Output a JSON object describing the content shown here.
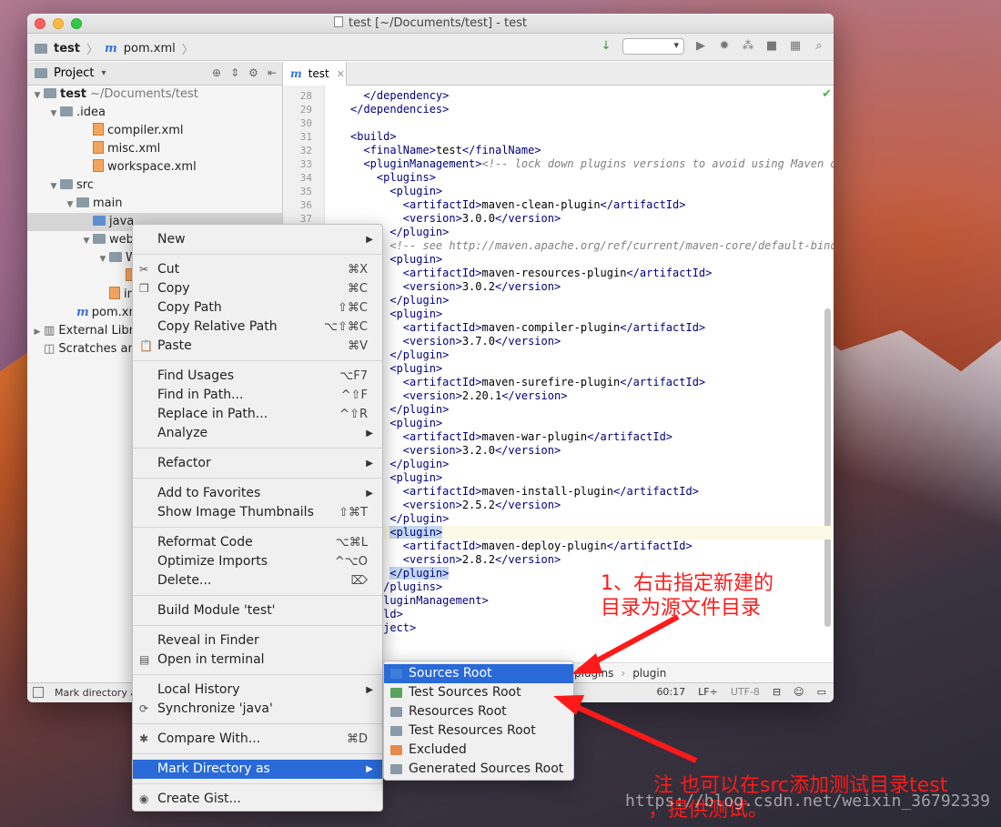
{
  "window": {
    "title": "test [~/Documents/test] - test"
  },
  "navbar": {
    "crumb_project": "test",
    "crumb_file": "pom.xml"
  },
  "project_panel": {
    "title": "Project",
    "tree": [
      {
        "label": "test",
        "suffix": "~/Documents/test",
        "indent": 0,
        "arrow": "▼",
        "icon": "folder"
      },
      {
        "label": ".idea",
        "indent": 1,
        "arrow": "▼",
        "icon": "folder"
      },
      {
        "label": "compiler.xml",
        "indent": 3,
        "arrow": "",
        "icon": "xml"
      },
      {
        "label": "misc.xml",
        "indent": 3,
        "arrow": "",
        "icon": "xml"
      },
      {
        "label": "workspace.xml",
        "indent": 3,
        "arrow": "",
        "icon": "xml"
      },
      {
        "label": "src",
        "indent": 1,
        "arrow": "▼",
        "icon": "folder"
      },
      {
        "label": "main",
        "indent": 2,
        "arrow": "▼",
        "icon": "folder"
      },
      {
        "label": "java",
        "indent": 3,
        "arrow": "",
        "icon": "folder",
        "selected": true
      },
      {
        "label": "web",
        "indent": 3,
        "arrow": "▼",
        "icon": "folder"
      },
      {
        "label": "W",
        "indent": 4,
        "arrow": "▼",
        "icon": "folder"
      },
      {
        "label": "",
        "indent": 5,
        "arrow": "",
        "icon": "xml"
      },
      {
        "label": "in",
        "indent": 4,
        "arrow": "",
        "icon": "xml"
      },
      {
        "label": "pom.xml",
        "indent": 2,
        "arrow": "",
        "icon": "m"
      },
      {
        "label": "External Libra",
        "indent": 0,
        "arrow": "▶",
        "icon": "lib"
      },
      {
        "label": "Scratches an",
        "indent": 0,
        "arrow": "",
        "icon": "scratch"
      }
    ]
  },
  "editor": {
    "tab_label": "test",
    "breadcrumb": [
      "plugins",
      "plugin"
    ],
    "lines": [
      {
        "n": "28",
        "indent": "  ",
        "parts": [
          [
            "tag",
            "</dependency>"
          ]
        ]
      },
      {
        "n": "29",
        "indent": "",
        "parts": [
          [
            "tag",
            "</dependencies>"
          ]
        ]
      },
      {
        "n": "30",
        "indent": "",
        "parts": []
      },
      {
        "n": "31",
        "indent": "",
        "parts": [
          [
            "tag",
            "<build>"
          ]
        ]
      },
      {
        "n": "32",
        "indent": "  ",
        "parts": [
          [
            "tag",
            "<finalName>"
          ],
          [
            "txt",
            "test"
          ],
          [
            "tag",
            "</finalName>"
          ]
        ]
      },
      {
        "n": "33",
        "indent": "  ",
        "parts": [
          [
            "tag",
            "<pluginManagement>"
          ],
          [
            "comment",
            "<!-- lock down plugins versions to avoid using Maven def"
          ]
        ]
      },
      {
        "n": "34",
        "indent": "    ",
        "parts": [
          [
            "tag",
            "<plugins>"
          ]
        ]
      },
      {
        "n": "35",
        "indent": "      ",
        "parts": [
          [
            "tag",
            "<plugin>"
          ]
        ]
      },
      {
        "n": "36",
        "indent": "        ",
        "parts": [
          [
            "tag",
            "<artifactId>"
          ],
          [
            "txt",
            "maven-clean-plugin"
          ],
          [
            "tag",
            "</artifactId>"
          ]
        ]
      },
      {
        "n": "37",
        "indent": "        ",
        "parts": [
          [
            "tag",
            "<version>"
          ],
          [
            "txt",
            "3.0.0"
          ],
          [
            "tag",
            "</version>"
          ]
        ]
      },
      {
        "n": "",
        "indent": "      ",
        "parts": [
          [
            "tag",
            "</plugin>"
          ]
        ]
      },
      {
        "n": "",
        "indent": "      ",
        "parts": [
          [
            "comment",
            "<!-- see http://maven.apache.org/ref/current/maven-core/default-bindin"
          ]
        ]
      },
      {
        "n": "",
        "indent": "      ",
        "parts": [
          [
            "tag",
            "<plugin>"
          ]
        ]
      },
      {
        "n": "",
        "indent": "        ",
        "parts": [
          [
            "tag",
            "<artifactId>"
          ],
          [
            "txt",
            "maven-resources-plugin"
          ],
          [
            "tag",
            "</artifactId>"
          ]
        ]
      },
      {
        "n": "",
        "indent": "        ",
        "parts": [
          [
            "tag",
            "<version>"
          ],
          [
            "txt",
            "3.0.2"
          ],
          [
            "tag",
            "</version>"
          ]
        ]
      },
      {
        "n": "",
        "indent": "      ",
        "parts": [
          [
            "tag",
            "</plugin>"
          ]
        ]
      },
      {
        "n": "",
        "indent": "      ",
        "parts": [
          [
            "tag",
            "<plugin>"
          ]
        ]
      },
      {
        "n": "",
        "indent": "        ",
        "parts": [
          [
            "tag",
            "<artifactId>"
          ],
          [
            "txt",
            "maven-compiler-plugin"
          ],
          [
            "tag",
            "</artifactId>"
          ]
        ]
      },
      {
        "n": "",
        "indent": "        ",
        "parts": [
          [
            "tag",
            "<version>"
          ],
          [
            "txt",
            "3.7.0"
          ],
          [
            "tag",
            "</version>"
          ]
        ]
      },
      {
        "n": "",
        "indent": "      ",
        "parts": [
          [
            "tag",
            "</plugin>"
          ]
        ]
      },
      {
        "n": "",
        "indent": "      ",
        "parts": [
          [
            "tag",
            "<plugin>"
          ]
        ]
      },
      {
        "n": "",
        "indent": "        ",
        "parts": [
          [
            "tag",
            "<artifactId>"
          ],
          [
            "txt",
            "maven-surefire-plugin"
          ],
          [
            "tag",
            "</artifactId>"
          ]
        ]
      },
      {
        "n": "",
        "indent": "        ",
        "parts": [
          [
            "tag",
            "<version>"
          ],
          [
            "txt",
            "2.20.1"
          ],
          [
            "tag",
            "</version>"
          ]
        ]
      },
      {
        "n": "",
        "indent": "      ",
        "parts": [
          [
            "tag",
            "</plugin>"
          ]
        ]
      },
      {
        "n": "",
        "indent": "      ",
        "parts": [
          [
            "tag",
            "<plugin>"
          ]
        ]
      },
      {
        "n": "",
        "indent": "        ",
        "parts": [
          [
            "tag",
            "<artifactId>"
          ],
          [
            "txt",
            "maven-war-plugin"
          ],
          [
            "tag",
            "</artifactId>"
          ]
        ]
      },
      {
        "n": "",
        "indent": "        ",
        "parts": [
          [
            "tag",
            "<version>"
          ],
          [
            "txt",
            "3.2.0"
          ],
          [
            "tag",
            "</version>"
          ]
        ]
      },
      {
        "n": "",
        "indent": "      ",
        "parts": [
          [
            "tag",
            "</plugin>"
          ]
        ]
      },
      {
        "n": "",
        "indent": "      ",
        "parts": [
          [
            "tag",
            "<plugin>"
          ]
        ]
      },
      {
        "n": "",
        "indent": "        ",
        "parts": [
          [
            "tag",
            "<artifactId>"
          ],
          [
            "txt",
            "maven-install-plugin"
          ],
          [
            "tag",
            "</artifactId>"
          ]
        ]
      },
      {
        "n": "",
        "indent": "        ",
        "parts": [
          [
            "tag",
            "<version>"
          ],
          [
            "txt",
            "2.5.2"
          ],
          [
            "tag",
            "</version>"
          ]
        ]
      },
      {
        "n": "",
        "indent": "      ",
        "parts": [
          [
            "tag",
            "</plugin>"
          ]
        ]
      },
      {
        "n": "",
        "indent": "      ",
        "parts": [
          [
            "tagsel",
            "<plugin>"
          ]
        ],
        "hl": true
      },
      {
        "n": "",
        "indent": "        ",
        "parts": [
          [
            "tag",
            "<artifactId>"
          ],
          [
            "txt",
            "maven-deploy-plugin"
          ],
          [
            "tag",
            "</artifactId>"
          ]
        ]
      },
      {
        "n": "",
        "indent": "        ",
        "parts": [
          [
            "tag",
            "<version>"
          ],
          [
            "txt",
            "2.8.2"
          ],
          [
            "tag",
            "</version>"
          ]
        ]
      },
      {
        "n": "",
        "indent": "      ",
        "parts": [
          [
            "tagsel",
            "</plugin>"
          ]
        ]
      },
      {
        "n": "",
        "indent": "    ",
        "parts": [
          [
            "tag",
            "</plugins>"
          ]
        ]
      },
      {
        "n": "",
        "indent": "  ",
        "parts": [
          [
            "tag",
            "</pluginManagement>"
          ]
        ]
      },
      {
        "n": "",
        "indent": "",
        "parts": [
          [
            "tag",
            "</build>"
          ]
        ]
      },
      {
        "n": "",
        "indent": "",
        "parts": [
          [
            "tag",
            "</project>"
          ]
        ]
      }
    ]
  },
  "status": {
    "message": "Mark directory as",
    "position": "60:17",
    "line_sep": "LF÷",
    "encoding": "UTF-8"
  },
  "context_menu": {
    "items": [
      {
        "label": "New",
        "sub": true
      },
      {
        "sep": true
      },
      {
        "label": "Cut",
        "shortcut": "⌘X",
        "icon": "✂"
      },
      {
        "label": "Copy",
        "shortcut": "⌘C",
        "icon": "❐"
      },
      {
        "label": "Copy Path",
        "shortcut": "⇧⌘C"
      },
      {
        "label": "Copy Relative Path",
        "shortcut": "⌥⇧⌘C"
      },
      {
        "label": "Paste",
        "shortcut": "⌘V",
        "icon": "📋"
      },
      {
        "sep": true
      },
      {
        "label": "Find Usages",
        "shortcut": "⌥F7"
      },
      {
        "label": "Find in Path...",
        "shortcut": "^⇧F"
      },
      {
        "label": "Replace in Path...",
        "shortcut": "^⇧R"
      },
      {
        "label": "Analyze",
        "sub": true
      },
      {
        "sep": true
      },
      {
        "label": "Refactor",
        "sub": true
      },
      {
        "sep": true
      },
      {
        "label": "Add to Favorites",
        "sub": true
      },
      {
        "label": "Show Image Thumbnails",
        "shortcut": "⇧⌘T"
      },
      {
        "sep": true
      },
      {
        "label": "Reformat Code",
        "shortcut": "⌥⌘L"
      },
      {
        "label": "Optimize Imports",
        "shortcut": "^⌥O"
      },
      {
        "label": "Delete...",
        "shortcut": "⌦"
      },
      {
        "sep": true
      },
      {
        "label": "Build Module 'test'"
      },
      {
        "sep": true
      },
      {
        "label": "Reveal in Finder"
      },
      {
        "label": "Open in terminal",
        "icon": "▤"
      },
      {
        "sep": true
      },
      {
        "label": "Local History",
        "sub": true
      },
      {
        "label": "Synchronize 'java'",
        "icon": "⟳"
      },
      {
        "sep": true
      },
      {
        "label": "Compare With...",
        "shortcut": "⌘D",
        "icon": "✱"
      },
      {
        "sep": true
      },
      {
        "label": "Mark Directory as",
        "sub": true,
        "active": true
      },
      {
        "sep": true
      },
      {
        "label": "Create Gist...",
        "icon": "◉"
      }
    ]
  },
  "submenu": {
    "items": [
      {
        "label": "Sources Root",
        "color": "#3b7fd6",
        "active": true
      },
      {
        "label": "Test Sources Root",
        "color": "#5aa35a"
      },
      {
        "label": "Resources Root",
        "color": "#8a9aa6"
      },
      {
        "label": "Test Resources Root",
        "color": "#8a9aa6"
      },
      {
        "label": "Excluded",
        "color": "#e58a4c"
      },
      {
        "label": "Generated Sources Root",
        "color": "#8a9aa6"
      }
    ]
  },
  "annotations": {
    "note1_line1": "1、右击指定新建的",
    "note1_line2": "目录为源文件目录",
    "note2_line1": "注 也可以在src添加测试目录test",
    "note2_line2": "，提供测试。",
    "watermark": "https://blog.csdn.net/weixin_36792339"
  },
  "colors": {
    "accent": "#2a6ad8",
    "annotation": "#ff1a1a"
  }
}
